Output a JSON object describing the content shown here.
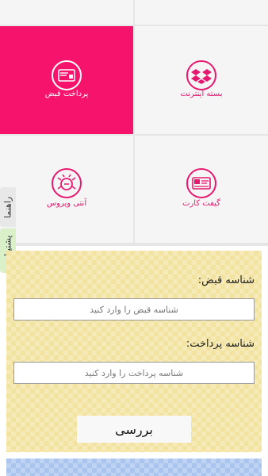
{
  "tiles": {
    "bill_payment": {
      "label": "پرداخت قبض",
      "icon": "bill-icon"
    },
    "internet_package": {
      "label": "بسته اینترنت",
      "icon": "dropbox-icon"
    },
    "antivirus": {
      "label": "آنتی ویروس",
      "icon": "bug-icon"
    },
    "gift_card": {
      "label": "گیفت کارت",
      "icon": "gift-card-icon"
    }
  },
  "side_tabs": {
    "help": "راهنما",
    "support": "پشتیبانی"
  },
  "form": {
    "bill_id_label": "شناسه قبض:",
    "bill_id_placeholder": "شناسه قبض را وارد کنید",
    "payment_id_label": "شناسه پرداخت:",
    "payment_id_placeholder": "شناسه پرداخت را وارد کنید",
    "submit_label": "بررسی"
  },
  "colors": {
    "accent": "#f5136b",
    "icon_pink": "#e5196f",
    "form_bg": "#f3e3a0",
    "bottom_bar": "#a9c5ee"
  }
}
